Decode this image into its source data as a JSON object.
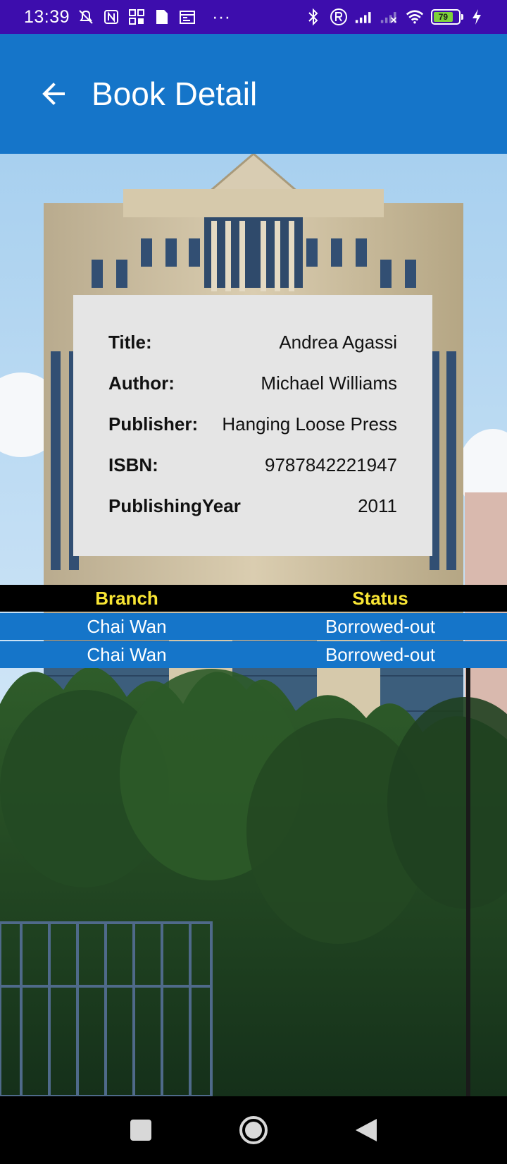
{
  "status_bar": {
    "time": "13:39",
    "dots": "···",
    "battery_level": "79",
    "icons_left": [
      "mute-icon",
      "nfc-icon",
      "grid-app-icon",
      "doc-icon",
      "calendar-icon"
    ],
    "icons_right": [
      "bluetooth-icon",
      "registered-icon",
      "signal-icon",
      "signal-off-icon",
      "wifi-icon",
      "battery-icon",
      "charging-icon"
    ]
  },
  "app_bar": {
    "title": "Book Detail",
    "back_icon": "arrow-left-icon"
  },
  "book": {
    "fields": [
      {
        "label": "Title:",
        "value": "Andrea Agassi"
      },
      {
        "label": "Author:",
        "value": "Michael Williams"
      },
      {
        "label": "Publisher:",
        "value": "Hanging Loose Press"
      },
      {
        "label": "ISBN:",
        "value": "9787842221947"
      },
      {
        "label": "PublishingYear",
        "value": "2011"
      }
    ]
  },
  "copies_table": {
    "headers": [
      "Branch",
      "Status"
    ],
    "rows": [
      [
        "Chai Wan",
        "Borrowed-out"
      ],
      [
        "Chai Wan",
        "Borrowed-out"
      ]
    ]
  },
  "colors": {
    "status_bar": "#3d0dad",
    "app_bar": "#1575c9",
    "header_text": "#f8e534",
    "card": "#e5e5e5"
  },
  "nav_bar": {
    "buttons": [
      "recents-square-icon",
      "home-circle-icon",
      "back-triangle-icon"
    ]
  }
}
